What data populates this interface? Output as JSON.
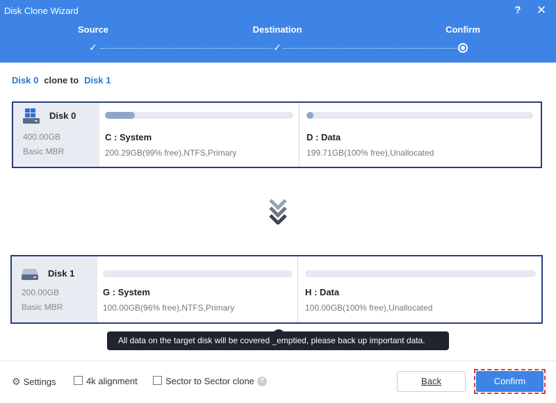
{
  "window": {
    "title": "Disk Clone Wizard",
    "help_label": "?",
    "close_label": "✕"
  },
  "steps": [
    {
      "label": "Source",
      "state": "done"
    },
    {
      "label": "Destination",
      "state": "done"
    },
    {
      "label": "Confirm",
      "state": "current"
    }
  ],
  "clone_line": {
    "source": "Disk 0",
    "connector": "clone to",
    "target": "Disk 1"
  },
  "source_disk": {
    "name": "Disk 0",
    "size": "400.00GB",
    "type": "Basic MBR",
    "icon": "windows-disk-icon",
    "partitions": [
      {
        "name": "C : System",
        "detail": "200.29GB(99% free),NTFS,Primary",
        "used_fraction": 0.16
      },
      {
        "name": "D : Data",
        "detail": "199.71GB(100% free),Unallocated",
        "used_fraction": 0.03
      }
    ]
  },
  "target_disk": {
    "name": "Disk 1",
    "size": "200.00GB",
    "type": "Basic MBR",
    "icon": "disk-drive-icon",
    "partitions": [
      {
        "name": "G : System",
        "detail": "100.00GB(96% free),NTFS,Primary",
        "used_fraction": 0.0
      },
      {
        "name": "H : Data",
        "detail": "100.00GB(100% free),Unallocated",
        "used_fraction": 0.0
      }
    ]
  },
  "tooltip": "All data on the target disk will be covered _emptied, please back up important data.",
  "footer": {
    "settings_label": "Settings",
    "alignment_label": "4k alignment",
    "alignment_checked": false,
    "sector_label": "Sector to Sector clone",
    "sector_checked": false,
    "back_label": "Back",
    "confirm_label": "Confirm"
  },
  "colors": {
    "header": "#3d84e6",
    "accent": "#2b74d8",
    "disk_border": "#2b3a7e",
    "highlight_border": "#e0393a"
  }
}
